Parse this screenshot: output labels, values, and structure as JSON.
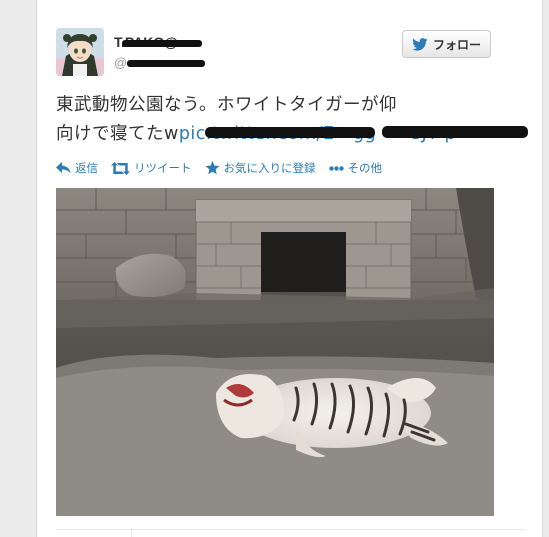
{
  "tweet": {
    "display_name": "T.PAKO@",
    "handle": "@",
    "text_line1": "東武動物公園なう。ホワイトタイガーが仰",
    "text_line2_plain": "向けで寝てたw",
    "text_line2_link": "pic.twitter.com/E  gg    8JT p"
  },
  "follow_button": {
    "label": "フォロー",
    "icon": "twitter-bird-icon"
  },
  "actions": [
    {
      "label": "返信",
      "icon": "reply-icon"
    },
    {
      "label": "リツイート",
      "icon": "retweet-icon"
    },
    {
      "label": "お気に入りに登録",
      "icon": "star-icon"
    },
    {
      "label": "その他",
      "icon": "more-dots-icon"
    }
  ],
  "colors": {
    "link": "#2b7bb9",
    "text": "#333333",
    "redaction": "#111111"
  }
}
